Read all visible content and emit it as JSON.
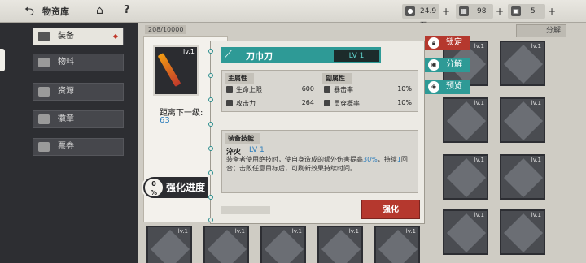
{
  "topbar": {
    "title": "物资库",
    "currency1": "24.9万",
    "currency2": "98",
    "currency3": "5"
  },
  "sidebar": {
    "items": [
      {
        "label": "装备",
        "active": true
      },
      {
        "label": "物料",
        "active": false
      },
      {
        "label": "资源",
        "active": false
      },
      {
        "label": "徽章",
        "active": false
      },
      {
        "label": "票券",
        "active": false
      }
    ]
  },
  "grid": {
    "count": "208/10000",
    "decompose_tag": "分解",
    "slot_level": "lv.1"
  },
  "item": {
    "icon_level": "lv.1",
    "name": "刀巾刀",
    "level": "LV 1",
    "distance_label": "距离下一级:",
    "distance_value": "63"
  },
  "stats": {
    "main_head": "主属性",
    "sub_head": "副属性",
    "main": [
      {
        "label": "生命上限",
        "value": "600"
      },
      {
        "label": "攻击力",
        "value": "264"
      }
    ],
    "sub": [
      {
        "label": "暴击率",
        "value": "10%"
      },
      {
        "label": "贯穿概率",
        "value": "10%"
      }
    ]
  },
  "skill": {
    "head": "装备技能",
    "name": "淬火",
    "level": "LV 1",
    "desc_pre": "装备者使用绝技时，使自身造成的额外伤害提高",
    "desc_hl": "30%",
    "desc_mid": "，持续",
    "desc_hl2": "1",
    "desc_post": "回合；击败任意目标后，可刷新效果持续时间。"
  },
  "actions": {
    "enhance": "强化",
    "lock": "锁定",
    "decompose": "分解",
    "preview": "预览",
    "progress_pct": "0",
    "progress_unit": "%",
    "progress_label": "强化进度"
  }
}
